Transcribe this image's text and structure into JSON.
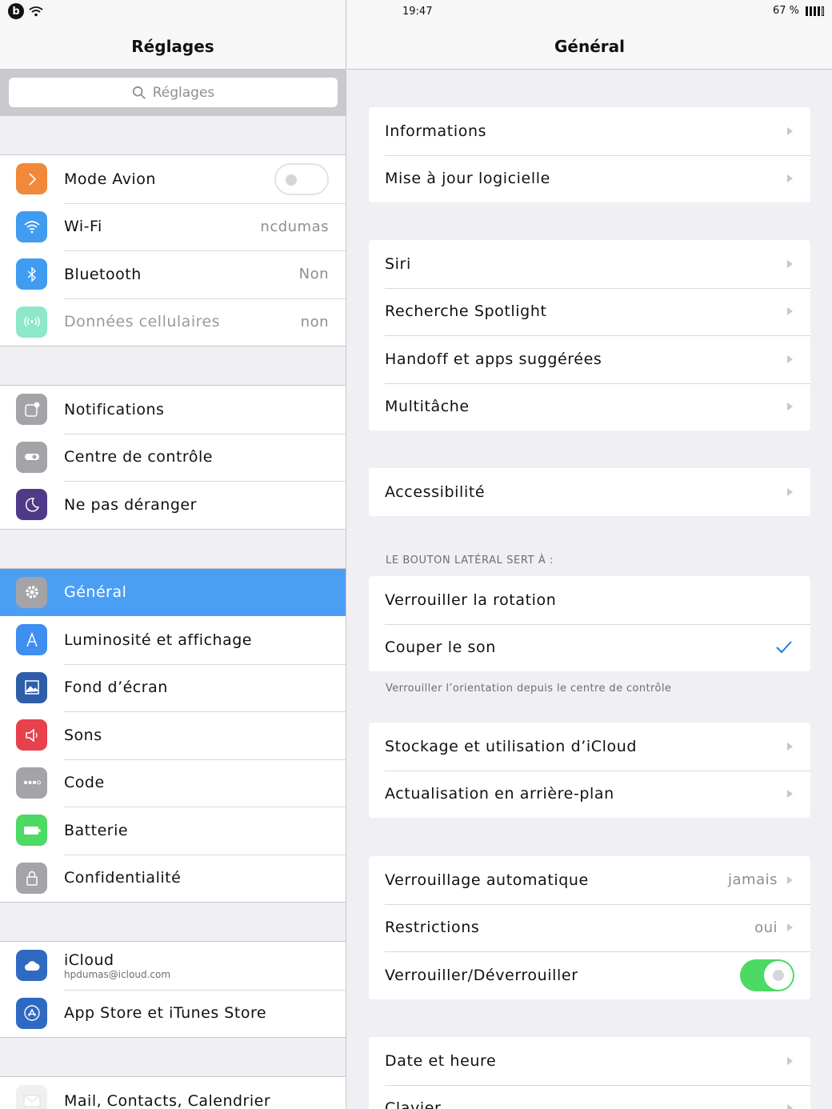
{
  "status_bar": {
    "time": "19:47",
    "battery_text": "67 %"
  },
  "master": {
    "title": "Réglages",
    "search_placeholder": "Réglages",
    "group1": [
      {
        "label": "Mode Avion",
        "icon": "airplane-icon",
        "color": "#f2883a"
      },
      {
        "label": "Wi-Fi",
        "value": "ncdumas",
        "icon": "wifi-icon",
        "color": "#3f9cf0"
      },
      {
        "label": "Bluetooth",
        "value": "Non",
        "icon": "bluetooth-icon",
        "color": "#3f9cf0"
      },
      {
        "label": "Données cellulaires",
        "value": "non",
        "icon": "cellular-icon",
        "color": "#8de8c9"
      }
    ],
    "group2": [
      {
        "label": "Notifications",
        "icon": "notifications-icon",
        "color": "#a3a3a8"
      },
      {
        "label": "Centre de contrôle",
        "icon": "control-center-icon",
        "color": "#a3a3a8"
      },
      {
        "label": "Ne pas déranger",
        "icon": "moon-icon",
        "color": "#4e3a86"
      }
    ],
    "group3": [
      {
        "label": "Général",
        "icon": "gear-icon",
        "color": "#a3a3a8"
      },
      {
        "label": "Luminosité et affichage",
        "icon": "brightness-icon",
        "color": "#3f8ef0"
      },
      {
        "label": "Fond d’écran",
        "icon": "wallpaper-icon",
        "color": "#2e5ea8"
      },
      {
        "label": "Sons",
        "icon": "speaker-icon",
        "color": "#e8404c"
      },
      {
        "label": "Code",
        "icon": "passcode-icon",
        "color": "#a3a3a8"
      },
      {
        "label": "Batterie",
        "icon": "battery-icon",
        "color": "#4cd964"
      },
      {
        "label": "Confidentialité",
        "icon": "lock-icon",
        "color": "#a3a3a8"
      }
    ],
    "group4": [
      {
        "label": "iCloud",
        "sub": "hpdumas@icloud.com",
        "icon": "cloud-icon",
        "color": "#2f6ac2"
      },
      {
        "label": "App Store et iTunes Store",
        "icon": "app-store-icon",
        "color": "#2f6ac2"
      }
    ],
    "group5": [
      {
        "label": "Mail, Contacts, Calendrier",
        "icon": "mail-icon",
        "color": "#f0f0f2"
      }
    ],
    "selected": "Général",
    "airplane_mode_on": false
  },
  "detail": {
    "title": "Général",
    "group1": [
      "Informations",
      "Mise à jour logicielle"
    ],
    "group2": [
      "Siri",
      "Recherche Spotlight",
      "Handoff et apps suggérées",
      "Multitâche"
    ],
    "group3": [
      "Accessibilité"
    ],
    "side_switch_header": "LE BOUTON LATÉRAL SERT À :",
    "side_switch_options": [
      "Verrouiller la rotation",
      "Couper le son"
    ],
    "side_switch_selected": "Couper le son",
    "side_switch_footer": "Verrouiller l’orientation depuis le centre de contrôle",
    "group5": [
      "Stockage et utilisation d’iCloud",
      "Actualisation en arrière-plan"
    ],
    "group6": [
      {
        "label": "Verrouillage automatique",
        "value": "jamais"
      },
      {
        "label": "Restrictions",
        "value": "oui"
      },
      {
        "label": "Verrouiller/Déverrouiller",
        "toggle": true
      }
    ],
    "group7": [
      "Date et heure",
      "Clavier"
    ]
  }
}
